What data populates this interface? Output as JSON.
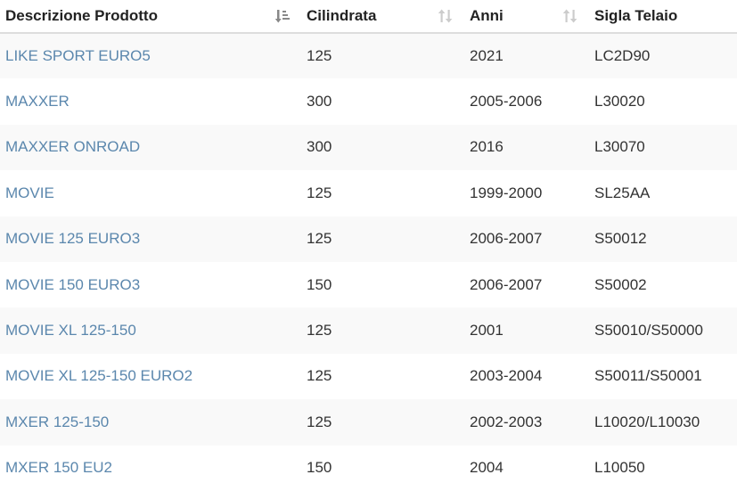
{
  "table": {
    "headers": [
      {
        "label": "Descrizione Prodotto",
        "sort": "sort-desc-icon"
      },
      {
        "label": "Cilindrata",
        "sort": "sort-both-icon"
      },
      {
        "label": "Anni",
        "sort": "sort-both-icon"
      },
      {
        "label": "Sigla Telaio",
        "sort": ""
      }
    ],
    "rows": [
      [
        "LIKE SPORT EURO5",
        "125",
        "2021",
        "LC2D90"
      ],
      [
        "MAXXER",
        "300",
        "2005-2006",
        "L30020"
      ],
      [
        "MAXXER ONROAD",
        "300",
        "2016",
        "L30070"
      ],
      [
        "MOVIE",
        "125",
        "1999-2000",
        "SL25AA"
      ],
      [
        "MOVIE 125 EURO3",
        "125",
        "2006-2007",
        "S50012"
      ],
      [
        "MOVIE 150 EURO3",
        "150",
        "2006-2007",
        "S50002"
      ],
      [
        "MOVIE XL 125-150",
        "125",
        "2001",
        "S50010/S50000"
      ],
      [
        "MOVIE XL 125-150 EURO2",
        "125",
        "2003-2004",
        "S50011/S50001"
      ],
      [
        "MXER 125-150",
        "125",
        "2002-2003",
        "L10020/L10030"
      ],
      [
        "MXER 150 EU2",
        "150",
        "2004",
        "L10050"
      ]
    ]
  },
  "colors": {
    "link": "#5b87ad",
    "text": "#333333",
    "stripe": "#f9f9f9",
    "header_border": "#dddddd"
  }
}
